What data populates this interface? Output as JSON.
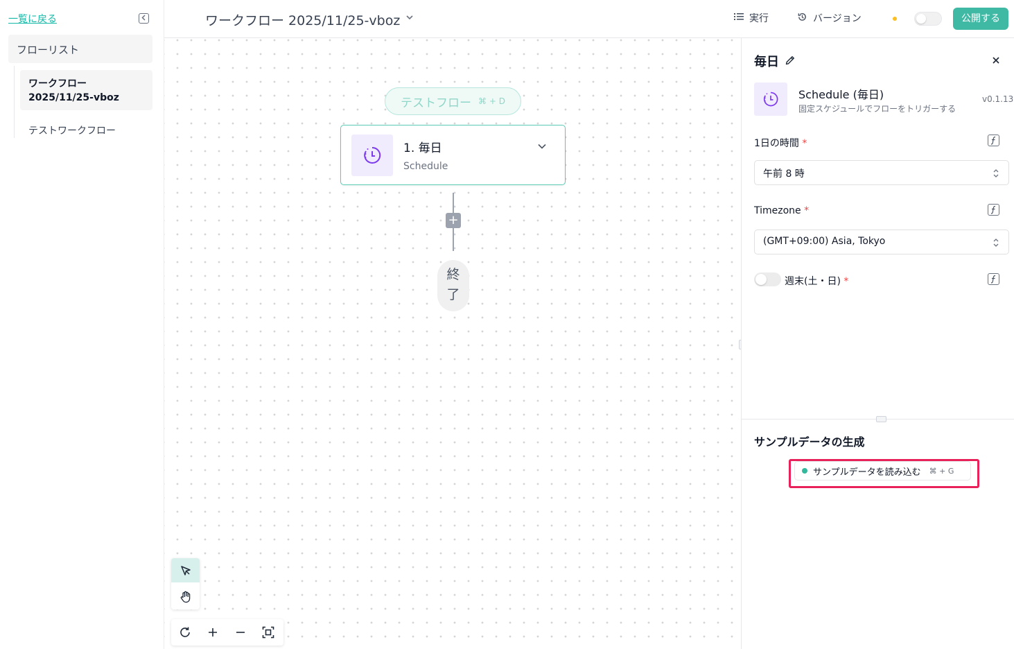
{
  "sidebar": {
    "back_link": "一覧に戻る",
    "list_header": "フローリスト",
    "items": [
      {
        "label": "ワークフロー 2025/11/25-vboz"
      },
      {
        "label": "テストワークフロー"
      }
    ]
  },
  "topbar": {
    "title": "ワークフロー 2025/11/25-vboz",
    "run_label": "実行",
    "version_label": "バージョン",
    "publish_label": "公開する",
    "status_color": "#fbbf24",
    "accent": "#3fb8a4"
  },
  "canvas": {
    "test_flow_label": "テストフロー",
    "test_flow_shortcut": "⌘ + D",
    "node_title": "1. 毎日",
    "node_subtitle": "Schedule",
    "add_symbol": "+",
    "end_label_1": "終",
    "end_label_2": "了"
  },
  "panel": {
    "title": "毎日",
    "trigger_name": "Schedule (毎日)",
    "trigger_desc": "固定スケジュールでフローをトリガーする",
    "version": "v0.1.13",
    "time_label": "1日の時間",
    "time_value": "午前 8 時",
    "tz_label": "Timezone",
    "tz_value": "(GMT+09:00) Asia, Tokyo",
    "weekend_label": "週末(土・日)",
    "required_mark": "*",
    "sample_title": "サンプルデータの生成",
    "load_label": "サンプルデータを読み込む",
    "load_shortcut": "⌘ + G"
  }
}
